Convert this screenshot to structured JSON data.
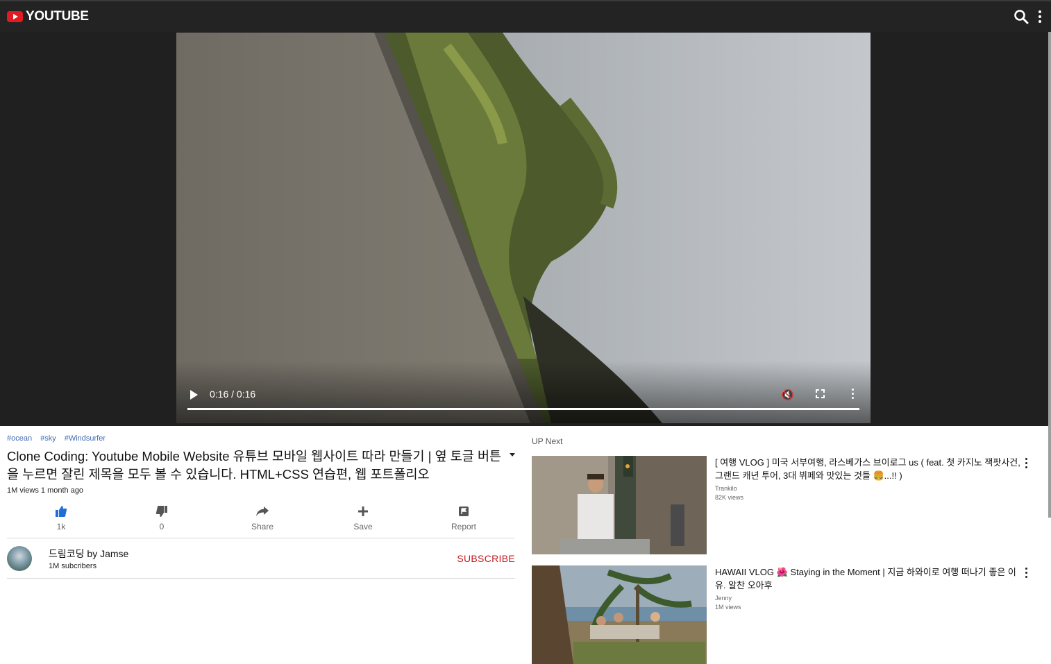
{
  "header": {
    "logo_text": "YOUTUBE"
  },
  "player": {
    "time": "0:16 / 0:16",
    "progress": 1.0
  },
  "video_info": {
    "tags": [
      "#ocean",
      "#sky",
      "#Windsurfer"
    ],
    "title": "Clone Coding: Youtube Mobile Website 유튜브 모바일 웹사이트 따라 만들기 | 옆 토글 버튼을 누르면 잘린 제목을 모두 볼 수 있습니다. HTML+CSS 연습편, 웹 포트폴리오",
    "meta": "1M views 1 month ago",
    "actions": [
      {
        "label": "1k",
        "icon": "thumbs-up-icon"
      },
      {
        "label": "0",
        "icon": "thumbs-down-icon"
      },
      {
        "label": "Share",
        "icon": "share-icon"
      },
      {
        "label": "Save",
        "icon": "plus-icon"
      },
      {
        "label": "Report",
        "icon": "flag-icon"
      }
    ]
  },
  "channel": {
    "name": "드림코딩 by Jamse",
    "subscribers": "1M subcribers",
    "subscribe_label": "SUBSCRIBE"
  },
  "upnext": {
    "heading": "UP Next",
    "items": [
      {
        "title": "[ 여행 VLOG ] 미국 서부여행, 라스베가스 브이로그 us ( feat. 첫 카지노 잭팟사건, 그랜드 캐년 투어, 3대 뷔페와 맛있는 것들 🍔...!! )",
        "author": "Trankilo",
        "views": "82K views"
      },
      {
        "title": "HAWAII VLOG 🌺 Staying in the Moment | 지금 하와이로 여행 떠나기 좋은 이유. 알찬 오아후",
        "author": "Jenny",
        "views": "1M views"
      }
    ]
  },
  "colors": {
    "header_bg": "#232323",
    "accent_red": "#e11b22",
    "subscribe_red": "#c4191f",
    "tag_blue": "#3d6bb5"
  }
}
